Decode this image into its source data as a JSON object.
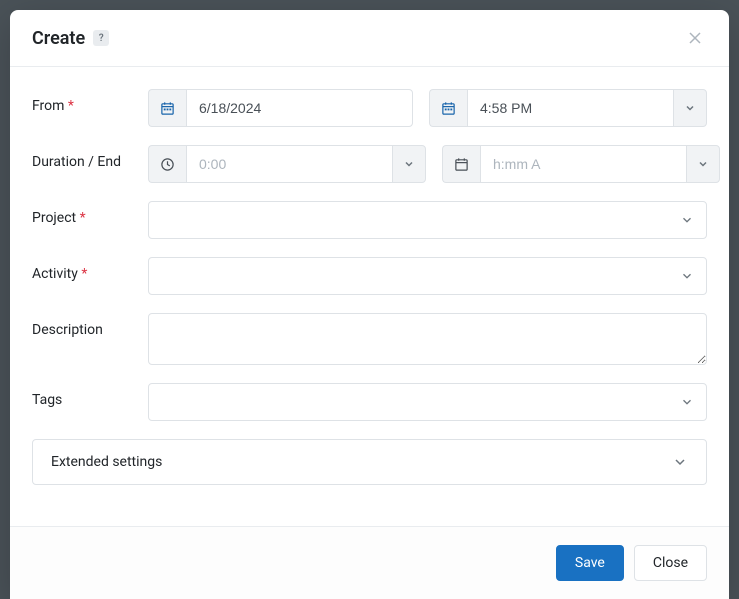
{
  "modal": {
    "title": "Create",
    "help_label": "?",
    "close_aria": "Close"
  },
  "form": {
    "from": {
      "label": "From",
      "required": "*",
      "date_value": "6/18/2024",
      "time_value": "4:58 PM"
    },
    "duration_end": {
      "label": "Duration / End",
      "duration_placeholder": "0:00",
      "duration_value": "",
      "end_placeholder": "h:mm A",
      "end_value": ""
    },
    "project": {
      "label": "Project",
      "required": "*"
    },
    "activity": {
      "label": "Activity",
      "required": "*"
    },
    "description": {
      "label": "Description",
      "value": ""
    },
    "tags": {
      "label": "Tags"
    },
    "extended": {
      "label": "Extended settings"
    }
  },
  "footer": {
    "save_label": "Save",
    "close_label": "Close"
  }
}
